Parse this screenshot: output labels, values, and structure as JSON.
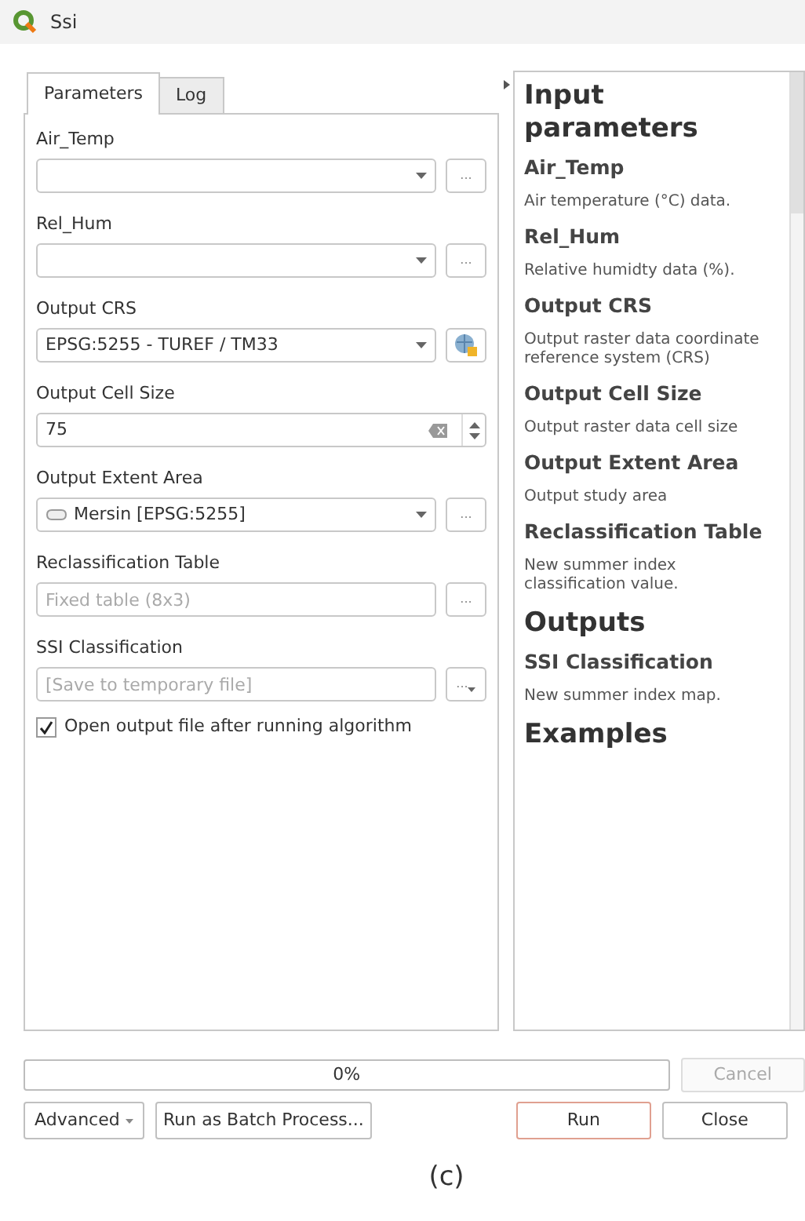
{
  "window": {
    "title": "Ssi"
  },
  "tabs": [
    {
      "label": "Parameters",
      "selected": true
    },
    {
      "label": "Log",
      "selected": false
    }
  ],
  "parameters": [
    {
      "kind": "combo",
      "label": "Air_Temp",
      "button": "..."
    },
    {
      "kind": "combo",
      "label": "Rel_Hum",
      "button": "..."
    },
    {
      "kind": "crs",
      "label": "Output CRS",
      "value": "EPSG:5255 - TUREF / TM33"
    },
    {
      "kind": "spin",
      "label": "Output Cell Size",
      "value": "75"
    },
    {
      "kind": "extent",
      "label": "Output Extent Area",
      "value": "Mersin [EPSG:5255]",
      "button": "..."
    },
    {
      "kind": "text",
      "label": "Reclassification Table",
      "placeholder": "Fixed table (8x3)",
      "button": "..."
    },
    {
      "kind": "output",
      "label": "SSI Classification",
      "placeholder": "[Save to temporary file]",
      "button": "..."
    }
  ],
  "open_output": {
    "label": "Open output file after running algorithm",
    "checked": true
  },
  "help": [
    {
      "kind": "h1",
      "text": "Input parameters"
    },
    {
      "kind": "h2",
      "text": "Air_Temp"
    },
    {
      "kind": "p",
      "text": "Air temperature (°C) data."
    },
    {
      "kind": "h2",
      "text": "Rel_Hum"
    },
    {
      "kind": "p",
      "text": "Relative humidty data (%)."
    },
    {
      "kind": "h2",
      "text": "Output CRS"
    },
    {
      "kind": "p",
      "text": "Output raster data coordinate reference system (CRS)"
    },
    {
      "kind": "h2",
      "text": "Output Cell Size"
    },
    {
      "kind": "p",
      "text": "Output raster data cell size"
    },
    {
      "kind": "h2",
      "text": "Output Extent Area"
    },
    {
      "kind": "p",
      "text": "Output study area"
    },
    {
      "kind": "h2",
      "text": "Reclassification Table"
    },
    {
      "kind": "p",
      "text": "New summer index classification value."
    },
    {
      "kind": "h1",
      "text": "Outputs"
    },
    {
      "kind": "h2",
      "text": "SSI Classification"
    },
    {
      "kind": "p",
      "text": "New summer index map."
    },
    {
      "kind": "h1",
      "text": "Examples"
    }
  ],
  "progress": {
    "text": "0%",
    "level": 0
  },
  "buttons": [
    {
      "kind": "menu",
      "label": "Advanced",
      "default": false,
      "disabled": false
    },
    {
      "kind": "batch",
      "label": "Run as Batch Process...",
      "default": false,
      "disabled": false
    },
    {
      "kind": "run",
      "label": "Run",
      "default": true,
      "disabled": false
    },
    {
      "kind": "close",
      "label": "Close",
      "default": false,
      "disabled": false
    }
  ],
  "cancel": {
    "label": "Cancel",
    "disabled": true
  },
  "caption": "(c)"
}
